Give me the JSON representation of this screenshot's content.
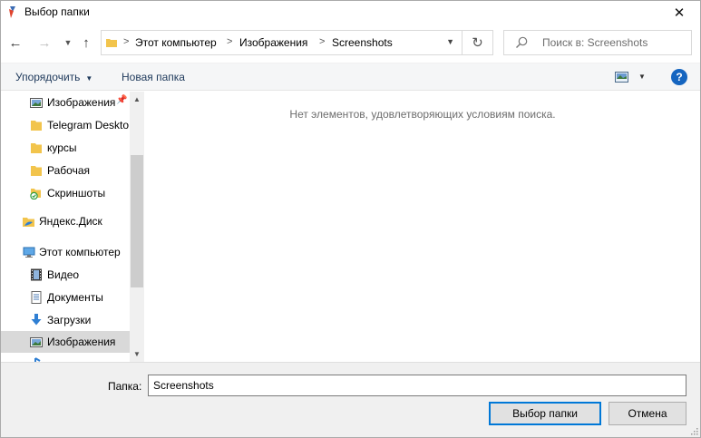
{
  "window": {
    "title": "Выбор папки"
  },
  "address": {
    "crumbs": [
      "Этот компьютер",
      "Изображения",
      "Screenshots"
    ]
  },
  "search": {
    "placeholder": "Поиск в: Screenshots"
  },
  "toolbar": {
    "organize_label": "Упорядочить",
    "new_folder_label": "Новая папка"
  },
  "sidebar": {
    "items": [
      {
        "label": "Изображения",
        "icon": "pictures-icon",
        "indent": 1,
        "pinned": true
      },
      {
        "label": "Telegram Deskto",
        "icon": "folder-icon",
        "indent": 1
      },
      {
        "label": "курсы",
        "icon": "folder-icon",
        "indent": 1
      },
      {
        "label": "Рабочая",
        "icon": "folder-icon",
        "indent": 1
      },
      {
        "label": "Скриншоты",
        "icon": "synced-folder-icon",
        "indent": 1
      },
      {
        "label": "Яндекс.Диск",
        "icon": "yandex-disk-icon",
        "indent": 0
      },
      {
        "label": "Этот компьютер",
        "icon": "computer-icon",
        "indent": 0
      },
      {
        "label": "Видео",
        "icon": "video-icon",
        "indent": 1
      },
      {
        "label": "Документы",
        "icon": "documents-icon",
        "indent": 1
      },
      {
        "label": "Загрузки",
        "icon": "downloads-icon",
        "indent": 1
      },
      {
        "label": "Изображения",
        "icon": "pictures-icon",
        "indent": 1,
        "selected": true
      }
    ]
  },
  "content": {
    "empty_message": "Нет элементов, удовлетворяющих условиям поиска."
  },
  "footer": {
    "folder_label": "Папка:",
    "folder_value": "Screenshots",
    "select_button": "Выбор папки",
    "cancel_button": "Отмена"
  },
  "colors": {
    "accent": "#0078d7",
    "folder": "#f2c44c",
    "selection": "#d9d9d9",
    "help": "#1565c0"
  }
}
